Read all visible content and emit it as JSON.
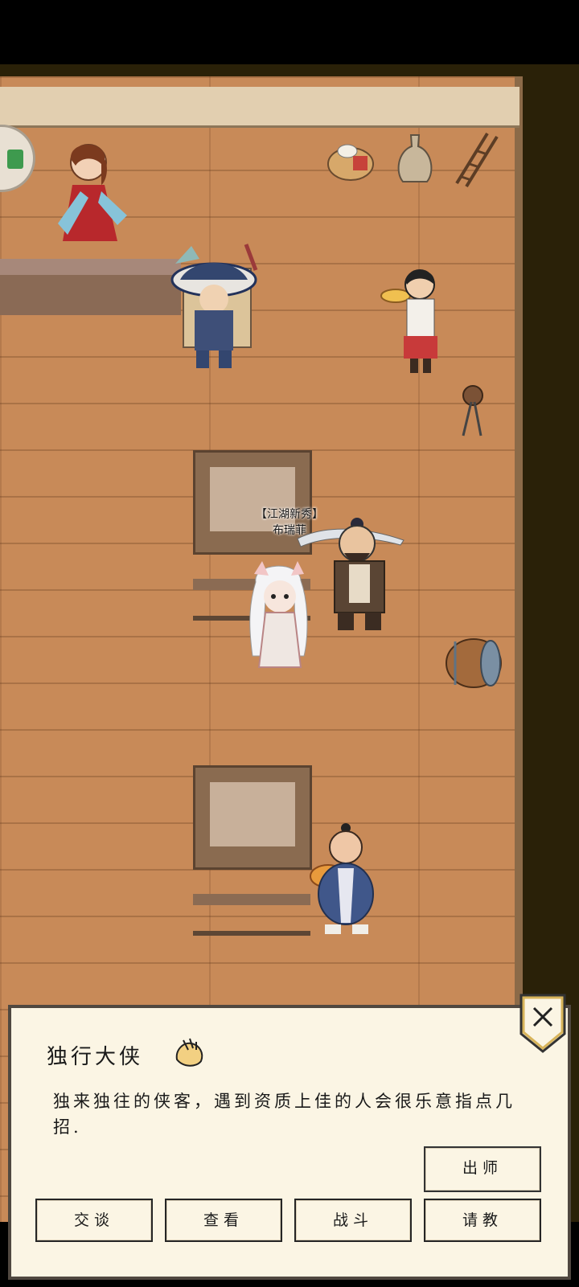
{
  "scene": {
    "npc_tag": "【江湖新秀】",
    "npc_name": "布瑞菲"
  },
  "dialog": {
    "title": "独行大侠",
    "description": "独来独往的侠客，遇到资质上佳的人会很乐意指点几招.",
    "buttons": {
      "chushi": "出师",
      "talk": "交谈",
      "view": "查看",
      "fight": "战斗",
      "ask": "请教"
    }
  },
  "icons": {
    "menu": "menu-icon",
    "close": "close-icon",
    "title_hand": "hand-icon"
  }
}
